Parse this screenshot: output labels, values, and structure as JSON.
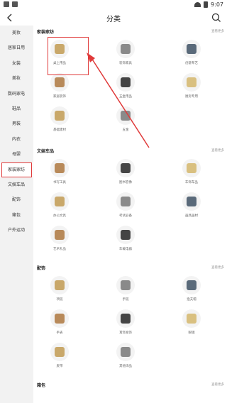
{
  "statusbar": {
    "time": "9:07"
  },
  "header": {
    "title": "分类"
  },
  "sidebar": {
    "items": [
      "美妆",
      "居家日用",
      "女装",
      "美妆",
      "数码家电",
      "鞋品",
      "男装",
      "内衣",
      "母婴",
      "家装家纺",
      "文娱车品",
      "配饰",
      "箱包",
      "户外运动"
    ],
    "active_index": 9
  },
  "sections": [
    {
      "title": "家装家纺",
      "more": "查看更多",
      "items": [
        {
          "label": "桌上用品",
          "icon": "desk-supplies-icon"
        },
        {
          "label": "装饰家具",
          "icon": "decor-furniture-icon"
        },
        {
          "label": "创意布艺",
          "icon": "fabric-icon"
        },
        {
          "label": "家居装饰",
          "icon": "home-decor-icon"
        },
        {
          "label": "五金用品",
          "icon": "hardware-icon"
        },
        {
          "label": "厨房专用",
          "icon": "kitchen-icon"
        },
        {
          "label": "基础建材",
          "icon": "building-material-icon"
        },
        {
          "label": "五金",
          "icon": "tools-icon"
        }
      ]
    },
    {
      "title": "文娱车品",
      "more": "查看更多",
      "items": [
        {
          "label": "书写工具",
          "icon": "pen-icon"
        },
        {
          "label": "图书音像",
          "icon": "book-icon"
        },
        {
          "label": "车饰车品",
          "icon": "car-accessory-icon"
        },
        {
          "label": "办公文具",
          "icon": "office-icon"
        },
        {
          "label": "考试必备",
          "icon": "exam-icon"
        },
        {
          "label": "画具画材",
          "icon": "paint-icon"
        },
        {
          "label": "艺术礼品",
          "icon": "gift-icon"
        },
        {
          "label": "车载电器",
          "icon": "car-charger-icon"
        }
      ]
    },
    {
      "title": "配饰",
      "more": "查看更多",
      "items": [
        {
          "label": "项链",
          "icon": "necklace-icon"
        },
        {
          "label": "手链",
          "icon": "bracelet-icon"
        },
        {
          "label": "渔夫帽",
          "icon": "bucket-hat-icon"
        },
        {
          "label": "手表",
          "icon": "watch-icon"
        },
        {
          "label": "耳饰发饰",
          "icon": "earring-icon"
        },
        {
          "label": "眼镜",
          "icon": "glasses-icon"
        },
        {
          "label": "皮带",
          "icon": "belt-icon"
        },
        {
          "label": "其他饰品",
          "icon": "accessory-icon"
        }
      ]
    },
    {
      "title": "箱包",
      "more": "查看更多",
      "items": []
    }
  ],
  "colors": {
    "accent": "#e03a3a"
  }
}
